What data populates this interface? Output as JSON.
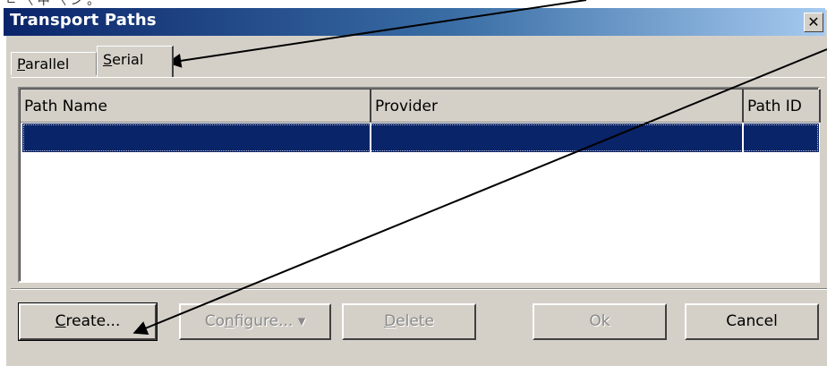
{
  "caption": "ㄹ 〈 中 〈 ン 。",
  "window": {
    "title": "Transport Paths",
    "close_glyph": "✕"
  },
  "tabs": [
    {
      "label": "Parallel",
      "accel": "P",
      "rest": "arallel",
      "selected": false
    },
    {
      "label": "Serial",
      "accel": "S",
      "rest": "erial",
      "selected": true
    }
  ],
  "list": {
    "columns": [
      "Path Name",
      "Provider",
      "Path ID"
    ],
    "rows": [
      {
        "path_name": "",
        "provider": "",
        "path_id": "",
        "selected": true
      }
    ]
  },
  "buttons": {
    "create": {
      "label": "Create...",
      "accel": "C",
      "rest": "reate..."
    },
    "configure": {
      "label": "Configure... ▾",
      "pre": "Co",
      "accel": "n",
      "rest": "figure... ▾",
      "enabled": false
    },
    "delete": {
      "label": "Delete",
      "accel": "D",
      "rest": "elete",
      "enabled": false
    },
    "ok": {
      "label": "Ok",
      "enabled": false
    },
    "cancel": {
      "label": "Cancel"
    }
  },
  "colors": {
    "title_start": "#0a246a",
    "title_end": "#a6caf0",
    "face": "#d4d0c8",
    "selection": "#0a246a"
  }
}
